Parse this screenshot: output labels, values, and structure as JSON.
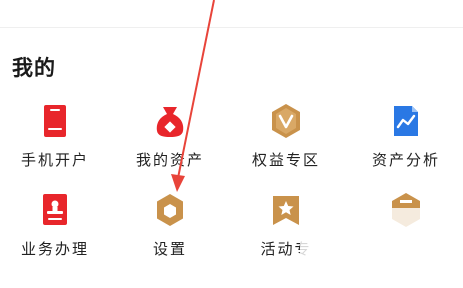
{
  "section": {
    "title": "我的"
  },
  "grid": {
    "items": [
      {
        "label": "手机开户",
        "icon": "phone-card-icon",
        "color": "#e8262b"
      },
      {
        "label": "我的资产",
        "icon": "money-bag-icon",
        "color": "#e8262b"
      },
      {
        "label": "权益专区",
        "icon": "v-badge-icon",
        "color": "#c9924b"
      },
      {
        "label": "资产分析",
        "icon": "trend-chart-icon",
        "color": "#2a78e4"
      },
      {
        "label": "业务办理",
        "icon": "stamp-icon",
        "color": "#e8262b"
      },
      {
        "label": "设置",
        "icon": "hex-gear-icon",
        "color": "#c9924b"
      },
      {
        "label": "活动专",
        "icon": "star-flag-icon",
        "color": "#c9924b"
      },
      {
        "label": "",
        "icon": "gold-hex-badge-icon",
        "color": "#c9924b"
      }
    ]
  },
  "annotation": {
    "arrow_color": "#e8443a"
  }
}
